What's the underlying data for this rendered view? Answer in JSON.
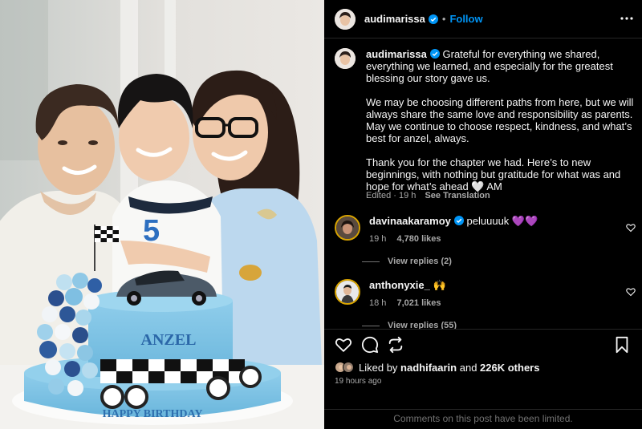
{
  "post": {
    "author": "audimarissa",
    "follow_label": "Follow",
    "separator": "•"
  },
  "caption": {
    "username": "audimarissa",
    "text": "Grateful for everything we shared, everything we learned, and especially for the greatest blessing our story gave us.\n\nWe may be choosing different paths from here, but we will always share the same love and responsibility as parents. May we continue to choose respect, kindness, and what’s best for anzel, always.\n\nThank you for the chapter we had. Here’s to new beginnings, with nothing but gratitude for what was and hope for what’s ahead 🤍 AM",
    "edited": "Edited · 19 h",
    "translate": "See Translation"
  },
  "photo": {
    "cake_name": "ANZEL",
    "cake_greeting": "HAPPY BIRTHDAY",
    "shirt_number": "5"
  },
  "comments": [
    {
      "username": "davinaakaramoy",
      "text": "peluuuuk 💜💜",
      "time": "19 h",
      "likes": "4,780 likes",
      "replies": "View replies (2)"
    },
    {
      "username": "anthonyxie_",
      "text": "🙌",
      "time": "18 h",
      "likes": "7,021 likes",
      "replies": "View replies (55)"
    }
  ],
  "likes_bar": {
    "liked_by_prefix": "Liked by ",
    "liked_by_user": "nadhifaarin",
    "and": " and ",
    "others": "226K others",
    "time": "19 hours ago"
  },
  "footer": {
    "limited": "Comments on this post have been limited."
  },
  "colors": {
    "accent": "#0095f6",
    "background": "#000000",
    "muted": "#a8a8a8",
    "cake_blue": "#7fc4e6"
  },
  "icons": [
    "verified-icon",
    "more-icon",
    "heart-icon",
    "comment-icon",
    "share-icon",
    "bookmark-icon"
  ]
}
